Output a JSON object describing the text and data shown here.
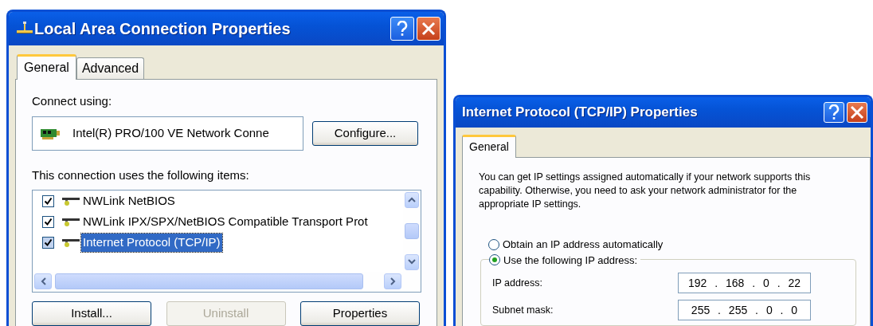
{
  "lan_dialog": {
    "title": "Local Area Connection Properties",
    "tabs": [
      {
        "label": "General",
        "selected": true
      },
      {
        "label": "Advanced",
        "selected": false
      }
    ],
    "connect_label": "Connect using:",
    "adapter": "Intel(R) PRO/100 VE Network Conne",
    "configure_button": "Configure...",
    "items_label": "This connection uses the following items:",
    "items": [
      {
        "label": "NWLink NetBIOS",
        "checked": true,
        "selected": false
      },
      {
        "label": "NWLink IPX/SPX/NetBIOS Compatible Transport Prot",
        "checked": true,
        "selected": false
      },
      {
        "label": "Internet Protocol (TCP/IP)",
        "checked": true,
        "selected": true
      }
    ],
    "buttons": [
      {
        "label": "Install...",
        "disabled": false
      },
      {
        "label": "Uninstall",
        "disabled": true
      },
      {
        "label": "Properties",
        "disabled": false
      }
    ]
  },
  "tcpip_dialog": {
    "title": "Internet Protocol (TCP/IP) Properties",
    "tabs": [
      {
        "label": "General",
        "selected": true
      }
    ],
    "description": "You can get IP settings assigned automatically if your network supports this capability. Otherwise, you need to ask your network administrator for the appropriate IP settings.",
    "options": [
      {
        "label": "Obtain an IP address automatically",
        "selected": false
      },
      {
        "label": "Use the following IP address:",
        "selected": true
      }
    ],
    "fields": [
      {
        "label": "IP address:",
        "value": "192 . 168 . 0 . 22"
      },
      {
        "label": "Subnet mask:",
        "value": "255 . 255 . 0 . 0"
      }
    ]
  }
}
